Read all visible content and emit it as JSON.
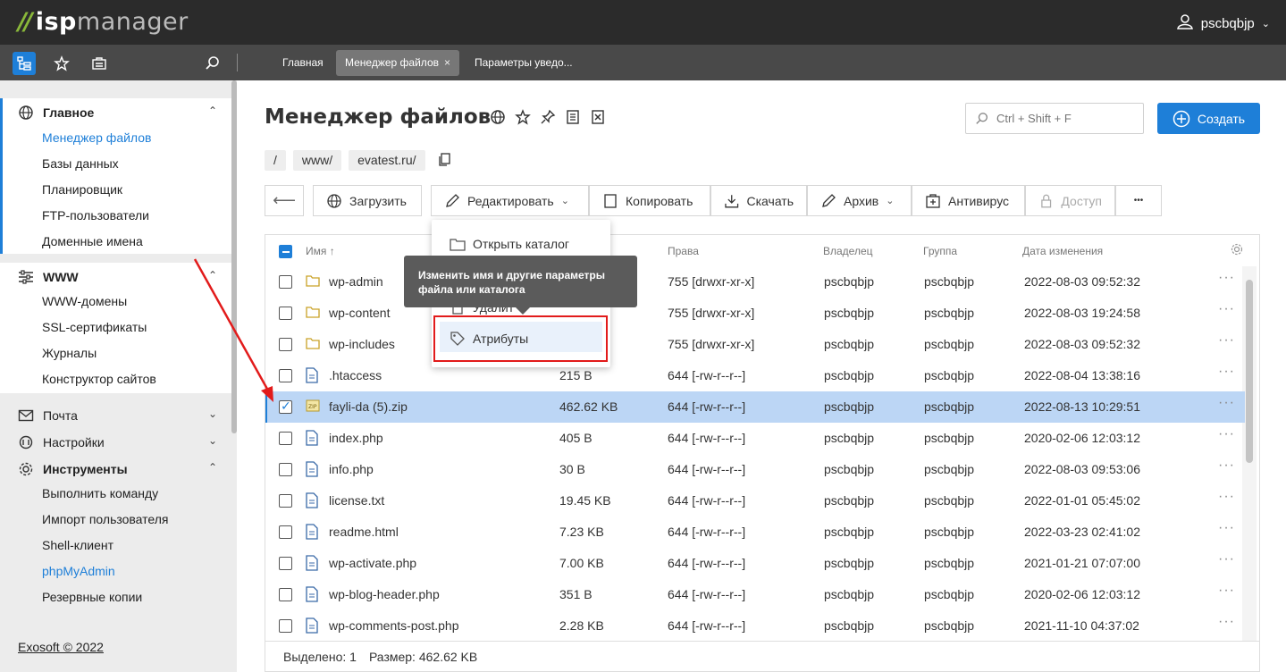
{
  "app": {
    "logo_mark": "//",
    "logo_isp": "isp",
    "logo_mgr": "manager"
  },
  "user": {
    "name": "pscbqbjp"
  },
  "tabs": [
    {
      "label": "Главная"
    },
    {
      "label": "Менеджер файлов",
      "close": "×"
    },
    {
      "label": "Параметры уведо..."
    }
  ],
  "sidebar": {
    "main": {
      "title": "Главное",
      "items": [
        "Менеджер файлов",
        "Базы данных",
        "Планировщик",
        "FTP-пользователи",
        "Доменные имена"
      ]
    },
    "www": {
      "title": "WWW",
      "items": [
        "WWW-домены",
        "SSL-сертификаты",
        "Журналы",
        "Конструктор сайтов"
      ]
    },
    "mail": {
      "title": "Почта"
    },
    "settings": {
      "title": "Настройки"
    },
    "tools": {
      "title": "Инструменты",
      "items": [
        "Выполнить команду",
        "Импорт пользователя",
        "Shell-клиент",
        "phpMyAdmin",
        "Резервные копии"
      ]
    },
    "footer": "Exosoft © 2022"
  },
  "page": {
    "title": "Менеджер файлов",
    "search_placeholder": "Ctrl + Shift + F",
    "create_label": "Создать",
    "breadcrumbs": [
      "/",
      "www/",
      "evatest.ru/"
    ]
  },
  "toolbar": {
    "back": "⟵",
    "upload": "Загрузить",
    "edit": "Редактировать",
    "copy": "Копировать",
    "download": "Скачать",
    "archive": "Архив",
    "antivirus": "Антивирус",
    "access": "Доступ",
    "more": "•••"
  },
  "table": {
    "headers": {
      "name": "Имя ↑",
      "rights": "Права",
      "owner": "Владелец",
      "group": "Группа",
      "modified": "Дата изменения"
    },
    "rows": [
      {
        "name": "wp-admin",
        "size": "",
        "rights": "755 [drwxr-xr-x]",
        "owner": "pscbqbjp",
        "group": "pscbqbjp",
        "date": "2022-08-03 09:52:32",
        "type": "folder"
      },
      {
        "name": "wp-content",
        "size": "",
        "rights": "755 [drwxr-xr-x]",
        "owner": "pscbqbjp",
        "group": "pscbqbjp",
        "date": "2022-08-03 19:24:58",
        "type": "folder"
      },
      {
        "name": "wp-includes",
        "size": "",
        "rights": "755 [drwxr-xr-x]",
        "owner": "pscbqbjp",
        "group": "pscbqbjp",
        "date": "2022-08-03 09:52:32",
        "type": "folder"
      },
      {
        "name": ".htaccess",
        "size": "215 B",
        "rights": "644 [-rw-r--r--]",
        "owner": "pscbqbjp",
        "group": "pscbqbjp",
        "date": "2022-08-04 13:38:16",
        "type": "file"
      },
      {
        "name": "fayli-da (5).zip",
        "size": "462.62 KB",
        "rights": "644 [-rw-r--r--]",
        "owner": "pscbqbjp",
        "group": "pscbqbjp",
        "date": "2022-08-13 10:29:51",
        "type": "zip",
        "selected": true
      },
      {
        "name": "index.php",
        "size": "405 B",
        "rights": "644 [-rw-r--r--]",
        "owner": "pscbqbjp",
        "group": "pscbqbjp",
        "date": "2020-02-06 12:03:12",
        "type": "file"
      },
      {
        "name": "info.php",
        "size": "30 B",
        "rights": "644 [-rw-r--r--]",
        "owner": "pscbqbjp",
        "group": "pscbqbjp",
        "date": "2022-08-03 09:53:06",
        "type": "file"
      },
      {
        "name": "license.txt",
        "size": "19.45 KB",
        "rights": "644 [-rw-r--r--]",
        "owner": "pscbqbjp",
        "group": "pscbqbjp",
        "date": "2022-01-01 05:45:02",
        "type": "file"
      },
      {
        "name": "readme.html",
        "size": "7.23 KB",
        "rights": "644 [-rw-r--r--]",
        "owner": "pscbqbjp",
        "group": "pscbqbjp",
        "date": "2022-03-23 02:41:02",
        "type": "file"
      },
      {
        "name": "wp-activate.php",
        "size": "7.00 KB",
        "rights": "644 [-rw-r--r--]",
        "owner": "pscbqbjp",
        "group": "pscbqbjp",
        "date": "2021-01-21 07:07:00",
        "type": "file"
      },
      {
        "name": "wp-blog-header.php",
        "size": "351 B",
        "rights": "644 [-rw-r--r--]",
        "owner": "pscbqbjp",
        "group": "pscbqbjp",
        "date": "2020-02-06 12:03:12",
        "type": "file"
      },
      {
        "name": "wp-comments-post.php",
        "size": "2.28 KB",
        "rights": "644 [-rw-r--r--]",
        "owner": "pscbqbjp",
        "group": "pscbqbjp",
        "date": "2021-11-10 04:37:02",
        "type": "file"
      }
    ]
  },
  "status": {
    "selected": "Выделено: 1",
    "size": "Размер: 462.62 KB"
  },
  "dropdown": {
    "open_dir": "Открыть каталог",
    "delete_partial": "Удалит",
    "attributes": "Атрибуты"
  },
  "tooltip": {
    "line1": "Изменить имя и другие параметры",
    "line2": "файла или каталога"
  },
  "colors": {
    "accent": "#1e7fd8",
    "annotation": "#e21b1b",
    "topbar": "#2b2b2b",
    "selected_row": "#bcd6f5"
  }
}
